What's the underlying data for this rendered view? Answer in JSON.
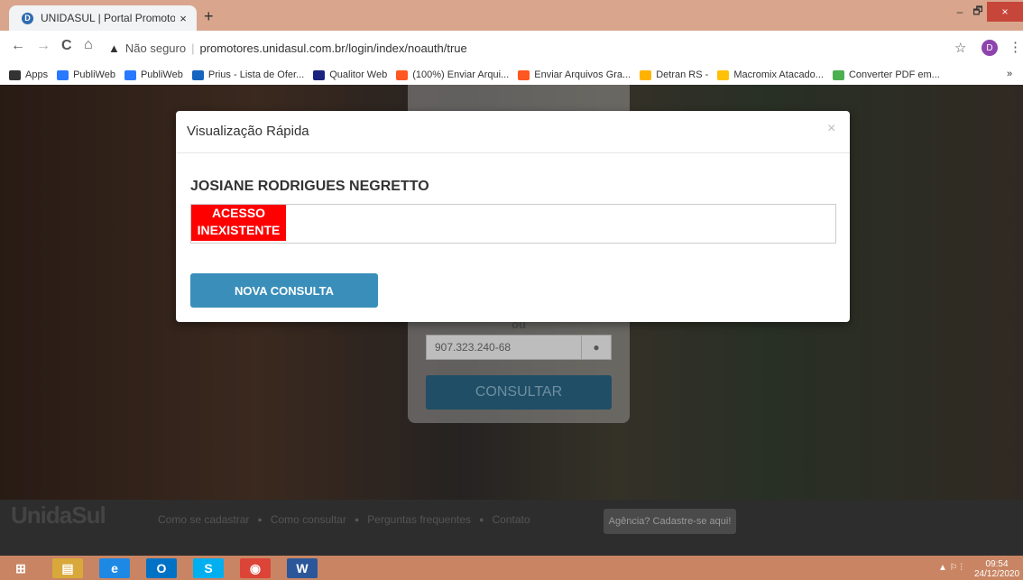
{
  "browser": {
    "tab_title": "UNIDASUL | Portal Promotores",
    "tab_close": "×",
    "new_tab": "+",
    "minimize": "–",
    "maximize": "🗗",
    "close": "×",
    "back": "←",
    "forward": "→",
    "reload": "C",
    "home": "⌂",
    "security_label": "Não seguro",
    "url": "promotores.unidasul.com.br/login/index/noauth/true",
    "star": "☆",
    "profile_initial": "D",
    "menu": "⋮"
  },
  "bookmarks": [
    {
      "label": "Apps",
      "color": "#333333"
    },
    {
      "label": "PubliWeb",
      "color": "#2979ff"
    },
    {
      "label": "PubliWeb",
      "color": "#2979ff"
    },
    {
      "label": "Prius - Lista de Ofer...",
      "color": "#1565c0"
    },
    {
      "label": "Qualitor Web",
      "color": "#1a237e"
    },
    {
      "label": "(100%) Enviar Arqui...",
      "color": "#ff5722"
    },
    {
      "label": "Enviar Arquivos Gra...",
      "color": "#ff5722"
    },
    {
      "label": "Detran RS -",
      "color": "#ffb300"
    },
    {
      "label": "Macromix Atacado...",
      "color": "#ffc107"
    },
    {
      "label": "Converter PDF em...",
      "color": "#4caf50"
    }
  ],
  "bookmarks_more": "»",
  "login": {
    "ou_label": "ou",
    "cpf_value": "907.323.240-68",
    "consultar_label": "CONSULTAR"
  },
  "modal": {
    "title": "Visualização Rápida",
    "close": "×",
    "name": "JOSIANE RODRIGUES NEGRETTO",
    "status_line1": "ACESSO",
    "status_line2": "INEXISTENTE",
    "button_label": "NOVA CONSULTA"
  },
  "footer": {
    "logo": "UnidaSul",
    "links": [
      "Como se cadastrar",
      "Como consultar",
      "Perguntas frequentes",
      "Contato"
    ],
    "dot": "●",
    "agency_button": "Agência? Cadastre-se aqui!"
  },
  "taskbar": {
    "apps": [
      {
        "label": "⊞",
        "color": "#c98563"
      },
      {
        "label": "▤",
        "color": "#d8a83a"
      },
      {
        "label": "e",
        "color": "#1e88e5"
      },
      {
        "label": "O",
        "color": "#0072c6"
      },
      {
        "label": "S",
        "color": "#00aff0"
      },
      {
        "label": "◉",
        "color": "#db4437"
      },
      {
        "label": "W",
        "color": "#2b579a"
      }
    ],
    "tray": "▲ ⚐ ⫶",
    "time": "09:54",
    "date": "24/12/2020"
  }
}
